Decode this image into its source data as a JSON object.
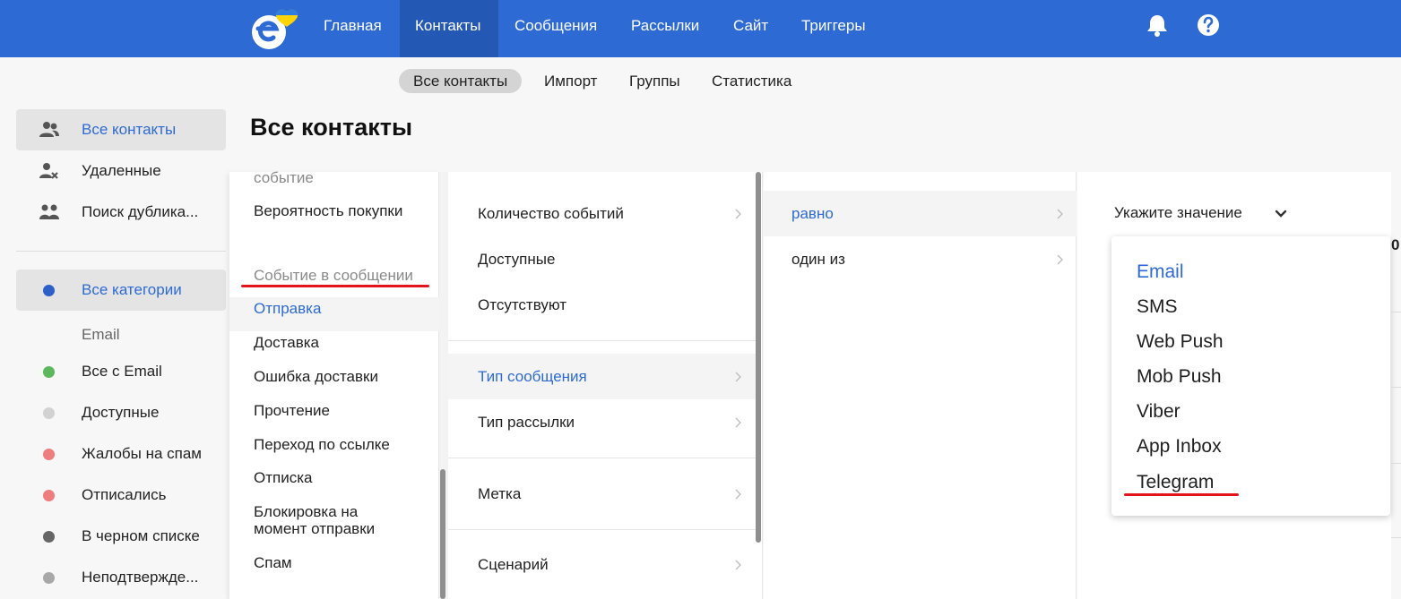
{
  "topnav": {
    "items": [
      "Главная",
      "Контакты",
      "Сообщения",
      "Рассылки",
      "Сайт",
      "Триггеры"
    ],
    "active": "Контакты",
    "bg_color": "#2d6ad4",
    "active_color": "#2458b5",
    "icons": [
      "bell-icon",
      "help-icon"
    ]
  },
  "subtabs": {
    "items": [
      "Все контакты",
      "Импорт",
      "Группы",
      "Статистика"
    ],
    "active": "Все контакты"
  },
  "sidebar": {
    "items": [
      {
        "label": "Все контакты",
        "icon": "users-icon",
        "active": true
      },
      {
        "label": "Удаленные",
        "icon": "user-remove-icon",
        "active": false
      },
      {
        "label": "Поиск дублика...",
        "icon": "duplicates-icon",
        "active": false
      }
    ],
    "categories": [
      {
        "label": "Все категории",
        "dot_color": "#2d5fc9",
        "active": true
      },
      {
        "label": "Все с Email",
        "dot_color": "#5cb85c",
        "active": false
      },
      {
        "label": "Доступные",
        "dot_color": "#d2d2d2",
        "active": false
      },
      {
        "label": "Жалобы на спам",
        "dot_color": "#ee7d7d",
        "active": false
      },
      {
        "label": "Отписались",
        "dot_color": "#ee7d7d",
        "active": false
      },
      {
        "label": "В черном списке",
        "dot_color": "#666666",
        "active": false
      },
      {
        "label": "Неподтвержде...",
        "dot_color": "#a8a8a8",
        "active": false
      }
    ],
    "subheading": "Email"
  },
  "page_title": "Все контакты",
  "panel_events": {
    "items": [
      "событие",
      "Вероятность покупки",
      "Событие в сообщении",
      "Отправка",
      "Доставка",
      "Ошибка доставки",
      "Прочтение",
      "Переход по ссылке",
      "Отписка",
      "Блокировка на момент отправки",
      "Спам"
    ],
    "header": "Событие в сообщении",
    "selected": "Отправка"
  },
  "panel_params": {
    "items": [
      "Количество событий",
      "Доступные",
      "Отсутствуют",
      "Тип сообщения",
      "Тип рассылки",
      "Метка",
      "Сценарий"
    ],
    "selected": "Тип сообщения"
  },
  "panel_operators": {
    "items": [
      "равно",
      "один из"
    ],
    "selected": "равно"
  },
  "panel_value": {
    "placeholder": "Укажите значение",
    "options": [
      "Email",
      "SMS",
      "Web Push",
      "Mob Push",
      "Viber",
      "App Inbox",
      "Telegram"
    ],
    "selected": "Email",
    "highlighted": "Telegram"
  },
  "accent_color": "#2d6ad4",
  "annotation_color": "#e3141c",
  "edge_fragment": "0"
}
